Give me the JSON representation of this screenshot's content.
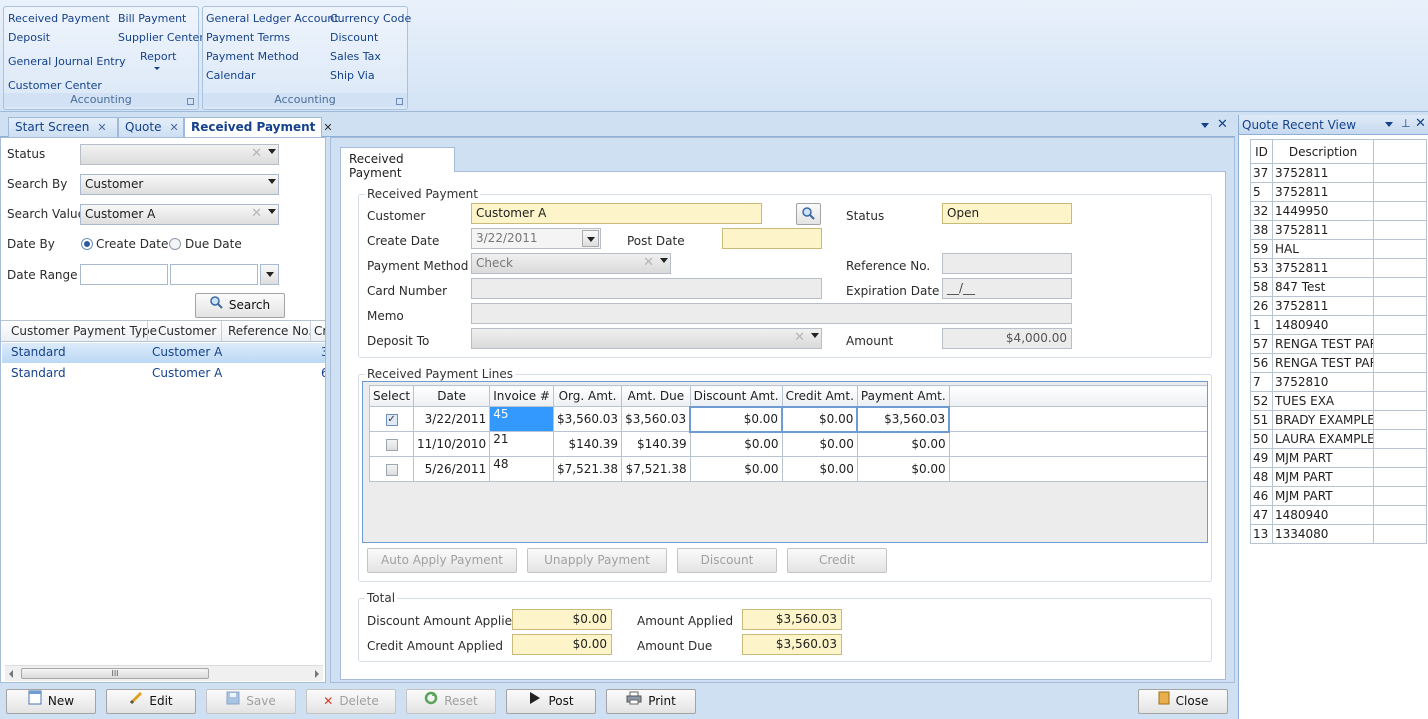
{
  "ribbon": {
    "g1": {
      "items": [
        "Received Payment",
        "Deposit",
        "General Journal Entry",
        "Customer Center",
        "Bill Payment",
        "Supplier Center",
        "Report"
      ],
      "title": "Accounting"
    },
    "g2": {
      "items": [
        "General Ledger Account",
        "Payment Terms",
        "Payment Method",
        "Calendar",
        "Currency Code",
        "Discount",
        "Sales Tax",
        "Ship Via"
      ],
      "title": "Accounting"
    }
  },
  "tabs": [
    "Start Screen",
    "Quote",
    "Received Payment"
  ],
  "search": {
    "status_label": "Status",
    "status_value": "",
    "searchby_label": "Search By",
    "searchby_value": "Customer",
    "searchvalue_label": "Search Value",
    "searchvalue_value": "Customer A",
    "dateby_label": "Date By",
    "radio_create": "Create Date",
    "radio_due": "Due Date",
    "daterange_label": "Date Range",
    "search_button": "Search"
  },
  "results": {
    "columns": [
      "Customer Payment Type",
      "Customer",
      "Reference No.",
      "Cr"
    ],
    "rows": [
      [
        "Standard",
        "Customer A",
        "",
        "3"
      ],
      [
        "Standard",
        "Customer A",
        "",
        "6"
      ]
    ],
    "scroll_grip": "III"
  },
  "form": {
    "tab": "Received Payment",
    "header_group": "Received Payment",
    "customer_label": "Customer",
    "customer_value": "Customer A",
    "status_label": "Status",
    "status_value": "Open",
    "create_date_label": "Create Date",
    "create_date_value": "3/22/2011",
    "post_date_label": "Post Date",
    "post_date_value": "",
    "payment_method_label": "Payment Method",
    "payment_method_value": "Check",
    "reference_label": "Reference No.",
    "reference_value": "",
    "card_label": "Card Number",
    "card_value": "",
    "expiration_label": "Expiration Date",
    "expiration_value": "__/__",
    "memo_label": "Memo",
    "memo_value": "",
    "deposit_label": "Deposit To",
    "deposit_value": "",
    "amount_label": "Amount",
    "amount_value": "$4,000.00"
  },
  "lines": {
    "group": "Received Payment Lines",
    "columns": [
      "Select",
      "Date",
      "Invoice #",
      "Org. Amt.",
      "Amt. Due",
      "Discount Amt.",
      "Credit Amt.",
      "Payment Amt."
    ],
    "rows": [
      {
        "checked": true,
        "date": "3/22/2011",
        "invoice": "45",
        "org": "$3,560.03",
        "due": "$3,560.03",
        "discount": "$0.00",
        "credit": "$0.00",
        "payment": "$3,560.03"
      },
      {
        "checked": false,
        "date": "11/10/2010",
        "invoice": "21",
        "org": "$140.39",
        "due": "$140.39",
        "discount": "$0.00",
        "credit": "$0.00",
        "payment": "$0.00"
      },
      {
        "checked": false,
        "date": "5/26/2011",
        "invoice": "48",
        "org": "$7,521.38",
        "due": "$7,521.38",
        "discount": "$0.00",
        "credit": "$0.00",
        "payment": "$0.00"
      }
    ],
    "buttons": [
      "Auto Apply Payment",
      "Unapply Payment",
      "Discount",
      "Credit"
    ]
  },
  "total": {
    "group": "Total",
    "discount_label": "Discount Amount Applied",
    "discount_value": "$0.00",
    "credit_label": "Credit Amount Applied",
    "credit_value": "$0.00",
    "applied_label": "Amount Applied",
    "applied_value": "$3,560.03",
    "due_label": "Amount Due",
    "due_value": "$3,560.03"
  },
  "toolbar": {
    "new": "New",
    "edit": "Edit",
    "save": "Save",
    "delete": "Delete",
    "reset": "Reset",
    "post": "Post",
    "print": "Print",
    "close": "Close"
  },
  "recent": {
    "title": "Quote Recent View",
    "columns": [
      "ID",
      "Description"
    ],
    "rows": [
      [
        "37",
        "3752811"
      ],
      [
        "5",
        "3752811"
      ],
      [
        "32",
        "1449950"
      ],
      [
        "38",
        "3752811"
      ],
      [
        "59",
        "HAL"
      ],
      [
        "53",
        "3752811"
      ],
      [
        "58",
        "847 Test"
      ],
      [
        "26",
        "3752811"
      ],
      [
        "1",
        "1480940"
      ],
      [
        "57",
        "RENGA TEST PART"
      ],
      [
        "56",
        "RENGA TEST PART"
      ],
      [
        "7",
        "3752810"
      ],
      [
        "52",
        "TUES EXA"
      ],
      [
        "51",
        "BRADY EXAMPLE"
      ],
      [
        "50",
        "LAURA EXAMPLE"
      ],
      [
        "49",
        "MJM PART"
      ],
      [
        "48",
        "MJM PART"
      ],
      [
        "46",
        "MJM PART"
      ],
      [
        "47",
        "1480940"
      ],
      [
        "13",
        "1334080"
      ]
    ]
  },
  "colors": {
    "accent": "#15428b",
    "yellow_field": "#fdf5c9",
    "selection": "#3399ff"
  }
}
